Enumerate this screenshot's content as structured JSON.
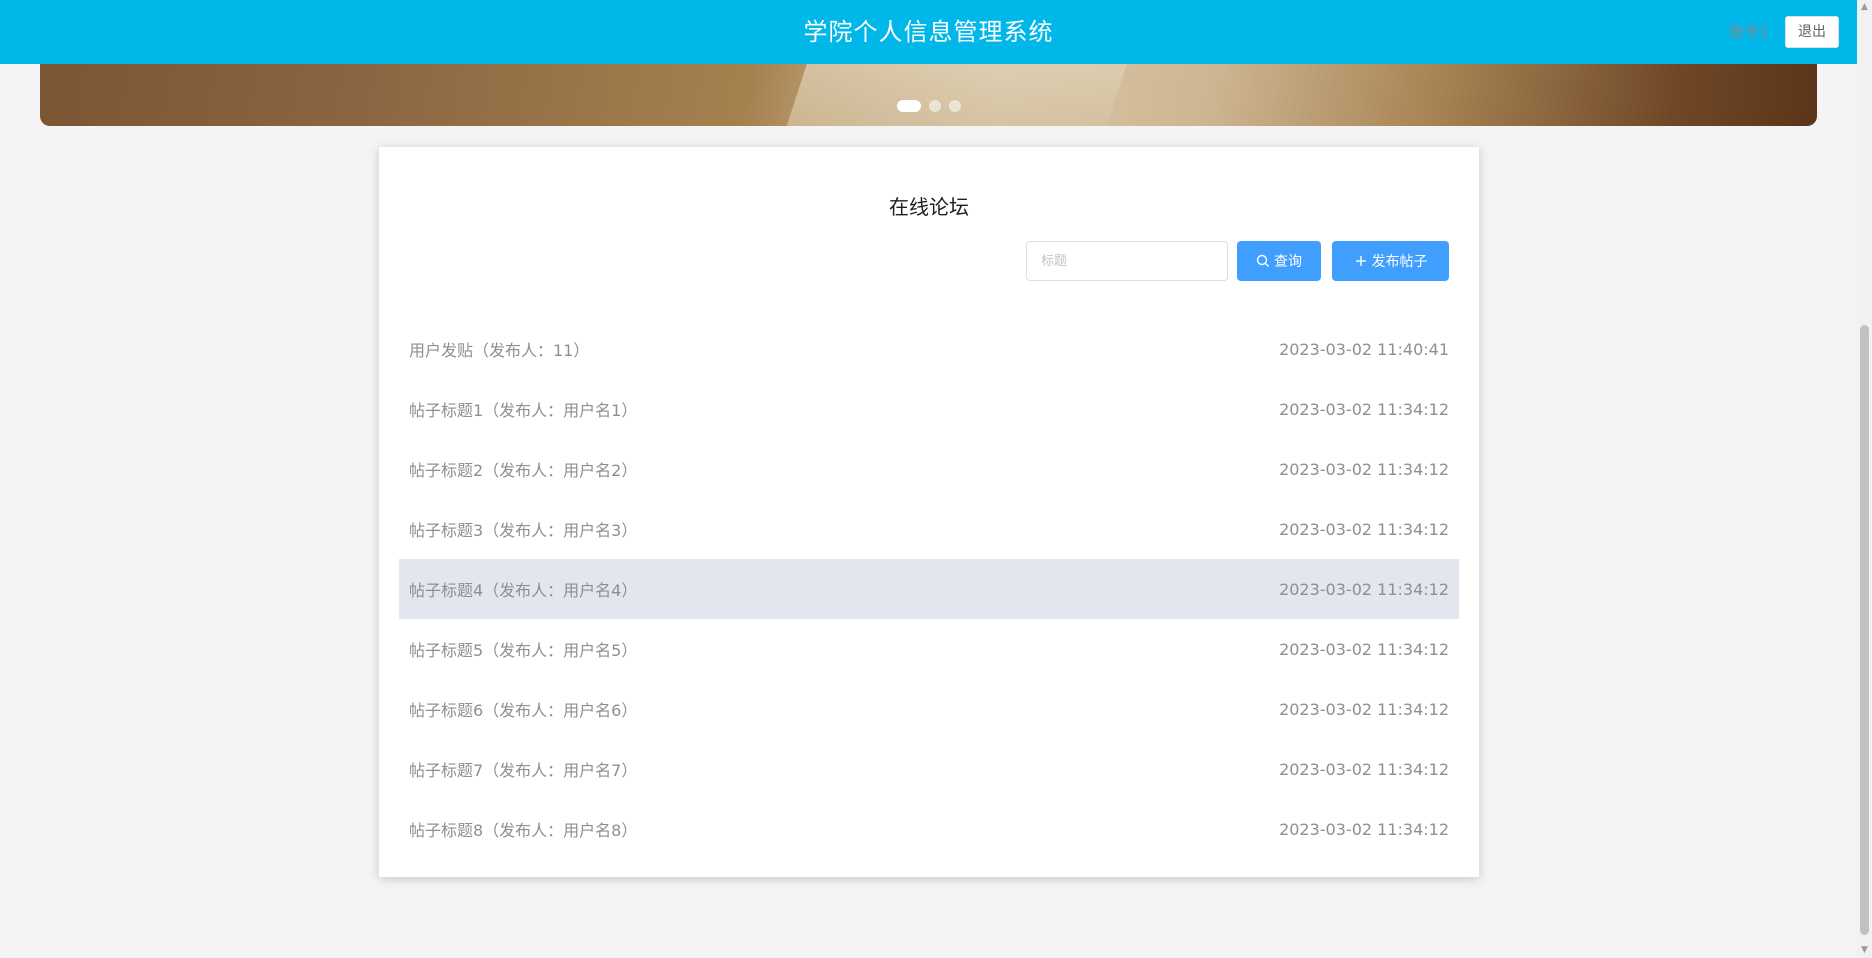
{
  "header": {
    "title": "学院个人信息管理系统",
    "account": "账号1",
    "logout_label": "退出",
    "bg_color": "#00b7ea"
  },
  "banner": {
    "slide_count": 3,
    "active_slide": 1
  },
  "forum": {
    "title": "在线论坛",
    "search_placeholder": "标题",
    "search_label": "查询",
    "post_label": "发布帖子",
    "accent": "#409eff",
    "posts": [
      {
        "title": "用户发贴（发布人：11）",
        "time": "2023-03-02 11:40:41"
      },
      {
        "title": "帖子标题1（发布人：用户名1）",
        "time": "2023-03-02 11:34:12"
      },
      {
        "title": "帖子标题2（发布人：用户名2）",
        "time": "2023-03-02 11:34:12"
      },
      {
        "title": "帖子标题3（发布人：用户名3）",
        "time": "2023-03-02 11:34:12"
      },
      {
        "title": "帖子标题4（发布人：用户名4）",
        "time": "2023-03-02 11:34:12"
      },
      {
        "title": "帖子标题5（发布人：用户名5）",
        "time": "2023-03-02 11:34:12"
      },
      {
        "title": "帖子标题6（发布人：用户名6）",
        "time": "2023-03-02 11:34:12"
      },
      {
        "title": "帖子标题7（发布人：用户名7）",
        "time": "2023-03-02 11:34:12"
      },
      {
        "title": "帖子标题8（发布人：用户名8）",
        "time": "2023-03-02 11:34:12"
      }
    ]
  }
}
